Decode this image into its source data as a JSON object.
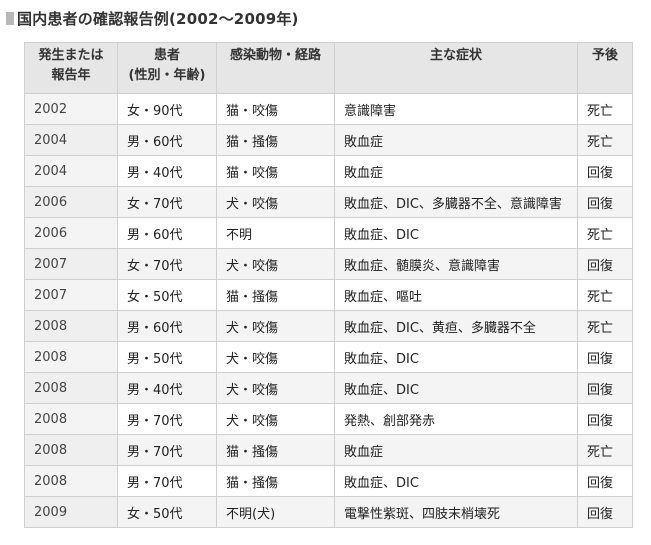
{
  "title": "国内患者の確認報告例(2002〜2009年)",
  "table": {
    "headers": {
      "year_line1": "発生または",
      "year_line2": "報告年",
      "patient_line1": "患者",
      "patient_line2": "(性別・年齢)",
      "source": "感染動物・経路",
      "symptoms": "主な症状",
      "outcome": "予後"
    },
    "rows": [
      {
        "year": "2002",
        "patient": "女・90代",
        "source": "猫・咬傷",
        "symptoms": "意識障害",
        "outcome": "死亡"
      },
      {
        "year": "2004",
        "patient": "男・60代",
        "source": "猫・掻傷",
        "symptoms": "敗血症",
        "outcome": "死亡"
      },
      {
        "year": "2004",
        "patient": "男・40代",
        "source": "猫・咬傷",
        "symptoms": "敗血症",
        "outcome": "回復"
      },
      {
        "year": "2006",
        "patient": "女・70代",
        "source": "犬・咬傷",
        "symptoms": "敗血症、DIC、多臓器不全、意識障害",
        "outcome": "回復"
      },
      {
        "year": "2006",
        "patient": "男・60代",
        "source": "不明",
        "symptoms": "敗血症、DIC",
        "outcome": "死亡"
      },
      {
        "year": "2007",
        "patient": "女・70代",
        "source": "犬・咬傷",
        "symptoms": "敗血症、髄膜炎、意識障害",
        "outcome": "回復"
      },
      {
        "year": "2007",
        "patient": "女・50代",
        "source": "猫・掻傷",
        "symptoms": "敗血症、嘔吐",
        "outcome": "死亡"
      },
      {
        "year": "2008",
        "patient": "男・60代",
        "source": "犬・咬傷",
        "symptoms": "敗血症、DIC、黄疸、多臓器不全",
        "outcome": "死亡"
      },
      {
        "year": "2008",
        "patient": "男・50代",
        "source": "犬・咬傷",
        "symptoms": "敗血症、DIC",
        "outcome": "回復"
      },
      {
        "year": "2008",
        "patient": "男・40代",
        "source": "犬・咬傷",
        "symptoms": "敗血症、DIC",
        "outcome": "回復"
      },
      {
        "year": "2008",
        "patient": "男・70代",
        "source": "犬・咬傷",
        "symptoms": "発熱、創部発赤",
        "outcome": "回復"
      },
      {
        "year": "2008",
        "patient": "男・70代",
        "source": "猫・掻傷",
        "symptoms": "敗血症",
        "outcome": "死亡"
      },
      {
        "year": "2008",
        "patient": "男・70代",
        "source": "猫・掻傷",
        "symptoms": "敗血症、DIC",
        "outcome": "回復"
      },
      {
        "year": "2009",
        "patient": "女・50代",
        "source": "不明(犬)",
        "symptoms": "電撃性紫斑、四肢末梢壊死",
        "outcome": "回復"
      }
    ]
  }
}
